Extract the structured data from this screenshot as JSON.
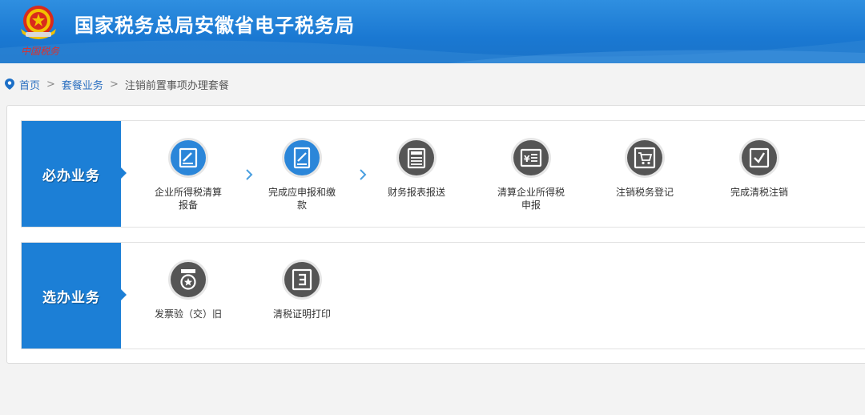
{
  "header": {
    "title": "国家税务总局安徽省电子税务局",
    "slogan": "中国税务"
  },
  "breadcrumb": {
    "home": "首页",
    "level2": "套餐业务",
    "current": "注销前置事项办理套餐",
    "separator": ">"
  },
  "sections": {
    "required": {
      "label": "必办业务",
      "items": [
        {
          "label": "企业所得税清算报备",
          "icon": "edit-icon",
          "active": true
        },
        {
          "label": "完成应申报和缴款",
          "icon": "report-icon",
          "active": true
        },
        {
          "label": "财务报表报送",
          "icon": "book-icon",
          "active": false
        },
        {
          "label": "清算企业所得税申报",
          "icon": "yuan-list-icon",
          "active": false
        },
        {
          "label": "注销税务登记",
          "icon": "cart-icon",
          "active": false
        },
        {
          "label": "完成清税注销",
          "icon": "check-icon",
          "active": false
        }
      ]
    },
    "optional": {
      "label": "选办业务",
      "items": [
        {
          "label": "发票验（交）旧",
          "icon": "medal-icon",
          "active": false
        },
        {
          "label": "清税证明打印",
          "icon": "document-icon",
          "active": false
        }
      ]
    }
  },
  "colors": {
    "header_blue": "#1a78d2",
    "label_blue": "#1c7fd6",
    "active_icon": "#2b86d9",
    "inactive_icon": "#555555",
    "link": "#2a6fc0"
  }
}
